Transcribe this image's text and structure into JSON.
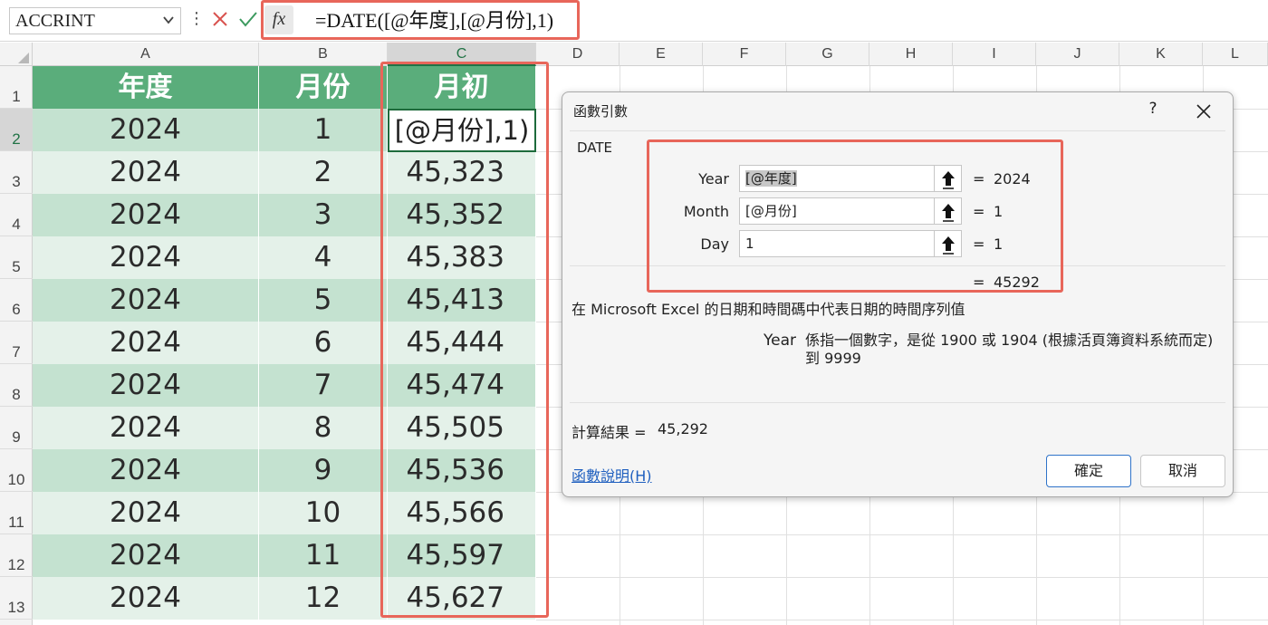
{
  "formula_bar": {
    "name_box": "ACCRINT",
    "fx_label": "fx",
    "formula": "=DATE([@年度],[@月份],1)"
  },
  "columns": [
    "A",
    "B",
    "C",
    "D",
    "E",
    "F",
    "G",
    "H",
    "I",
    "J",
    "K",
    "L"
  ],
  "rows": [
    "1",
    "2",
    "3",
    "4",
    "5",
    "6",
    "7",
    "8",
    "9",
    "10",
    "11",
    "12",
    "13"
  ],
  "table": {
    "headers": [
      "年度",
      "月份",
      "月初"
    ],
    "active_cell_text": "[@月份],1)",
    "rows": [
      {
        "year": "2024",
        "month": "1",
        "start": ""
      },
      {
        "year": "2024",
        "month": "2",
        "start": "45,323"
      },
      {
        "year": "2024",
        "month": "3",
        "start": "45,352"
      },
      {
        "year": "2024",
        "month": "4",
        "start": "45,383"
      },
      {
        "year": "2024",
        "month": "5",
        "start": "45,413"
      },
      {
        "year": "2024",
        "month": "6",
        "start": "45,444"
      },
      {
        "year": "2024",
        "month": "7",
        "start": "45,474"
      },
      {
        "year": "2024",
        "month": "8",
        "start": "45,505"
      },
      {
        "year": "2024",
        "month": "9",
        "start": "45,536"
      },
      {
        "year": "2024",
        "month": "10",
        "start": "45,566"
      },
      {
        "year": "2024",
        "month": "11",
        "start": "45,597"
      },
      {
        "year": "2024",
        "month": "12",
        "start": "45,627"
      }
    ]
  },
  "dialog": {
    "title": "函數引數",
    "help_glyph": "?",
    "function_name": "DATE",
    "args": [
      {
        "label": "Year",
        "input": "[@年度]",
        "eq": "=",
        "value": "2024"
      },
      {
        "label": "Month",
        "input": "[@月份]",
        "eq": "=",
        "value": "1"
      },
      {
        "label": "Day",
        "input": "1",
        "eq": "=",
        "value": "1"
      }
    ],
    "result_eq": "=",
    "result_value": "45292",
    "description": "在 Microsoft Excel 的日期和時間碼中代表日期的時間序列值",
    "arg_name": "Year",
    "arg_description": "係指一個數字，是從 1900 或 1904 (根據活頁簿資料系統而定) 到 9999",
    "calc_label": "計算結果 =",
    "calc_value": "45,292",
    "help_link": "函數說明(H)",
    "ok_label": "確定",
    "cancel_label": "取消"
  },
  "colors": {
    "header_green": "#5aad7b",
    "band_dark": "#c4e2d0",
    "band_light": "#e4f1e9",
    "highlight_red": "#e8665a",
    "excel_green": "#217346"
  }
}
